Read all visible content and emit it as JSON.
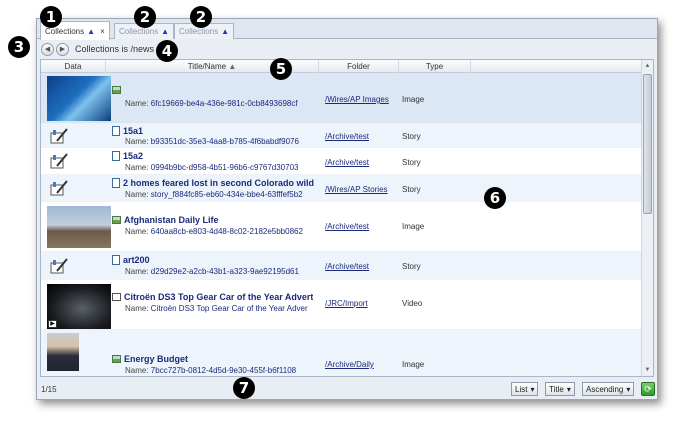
{
  "tabs": [
    {
      "label": "Collections",
      "active": true,
      "closable": true
    },
    {
      "label": "Collections",
      "active": false
    },
    {
      "label": "Collections",
      "active": false
    }
  ],
  "path_label": "Collections is /news",
  "columns": {
    "data": "Data",
    "title": "Title/Name",
    "folder": "Folder",
    "type": "Type"
  },
  "name_prefix": "Name:",
  "rows": [
    {
      "title": "",
      "name": "6fc19669-be4a-436e-981c-0cb8493698cf",
      "folder": "/Wires/AP Images",
      "type": "Image"
    },
    {
      "title": "15a1",
      "name": "b93351dc-35e3-4aa8-b785-4f6babdf9076",
      "folder": "/Archive/test",
      "type": "Story"
    },
    {
      "title": "15a2",
      "name": "0994b9bc-d958-4b51-96b6-c9767d30703",
      "folder": "/Archive/test",
      "type": "Story"
    },
    {
      "title": "2 homes feared lost in second Colorado wild",
      "name": "story_f884fc85-eb60-434e-bbe4-63fffef5b2",
      "folder": "/Wires/AP Stories",
      "type": "Story"
    },
    {
      "title": "Afghanistan Daily Life",
      "name": "640aa8cb-e803-4d48-8c02-2182e5bb0862",
      "folder": "/Archive/test",
      "type": "Image"
    },
    {
      "title": "art200",
      "name": "d29d29e2-a2cb-43b1-a323-9ae92195d61",
      "folder": "/Archive/test",
      "type": "Story"
    },
    {
      "title": "Citroën DS3 Top Gear Car of the Year Advert",
      "name": "Citroën DS3 Top Gear Car of the Year Adver",
      "folder": "/JRC/Import",
      "type": "Video"
    },
    {
      "title": "Energy Budget",
      "name": "7bcc727b-0812-4d5d-9e30-455f-b6f1108",
      "folder": "/Archive/Daily",
      "type": "Image"
    }
  ],
  "status": {
    "count": "1/15",
    "view": "List",
    "sort_field": "Title",
    "sort_order": "Ascending"
  },
  "callouts": [
    "1",
    "2",
    "2",
    "3",
    "4",
    "5",
    "6",
    "7"
  ]
}
